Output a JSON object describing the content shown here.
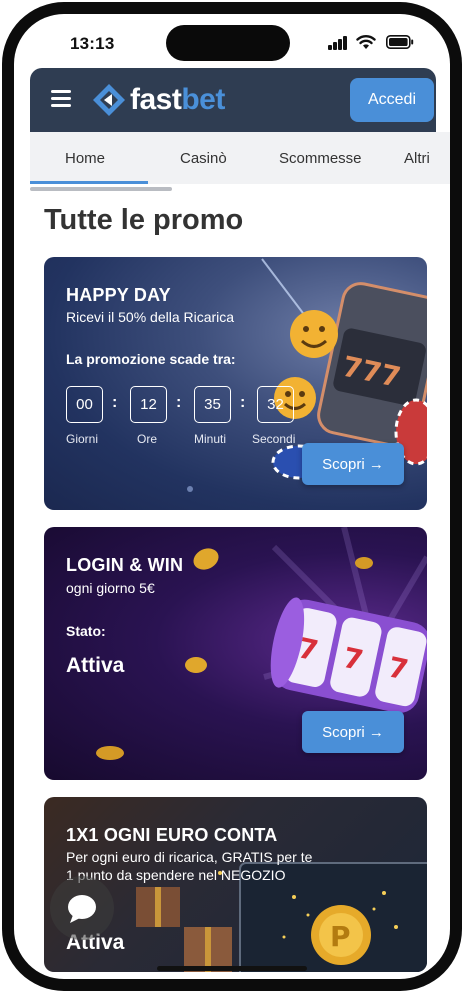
{
  "status_bar": {
    "time": "13:13"
  },
  "header": {
    "logo_text_1": "fast",
    "logo_text_2": "bet",
    "login_label": "Accedi",
    "brand_color": "#4a8fd8",
    "header_color": "#2f3d52"
  },
  "tabs": [
    {
      "label": "Home",
      "active": true
    },
    {
      "label": "Casinò",
      "active": false
    },
    {
      "label": "Scommesse",
      "active": false
    },
    {
      "label": "Altri",
      "active": false
    }
  ],
  "page_title": "Tutte le promo",
  "promos": [
    {
      "title": "HAPPY DAY",
      "subtitle": "Ricevi il 50% della Ricarica",
      "countdown_label": "La promozione scade tra:",
      "countdown": [
        {
          "value": "00",
          "unit": "Giorni"
        },
        {
          "value": "12",
          "unit": "Ore"
        },
        {
          "value": "35",
          "unit": "Minuti"
        },
        {
          "value": "32",
          "unit": "Secondi"
        }
      ],
      "cta": "Scopri →"
    },
    {
      "title": "LOGIN & WIN",
      "subtitle": "ogni giorno 5€",
      "state_label": "Stato:",
      "state_value": "Attiva",
      "cta": "Scopri →"
    },
    {
      "title": "1X1 OGNI EURO CONTA",
      "subtitle_line1": "Per ogni euro di ricarica, GRATIS per te",
      "subtitle_line2": "1 punto da spendere nel NEGOZIO",
      "state_value": "Attiva"
    }
  ]
}
